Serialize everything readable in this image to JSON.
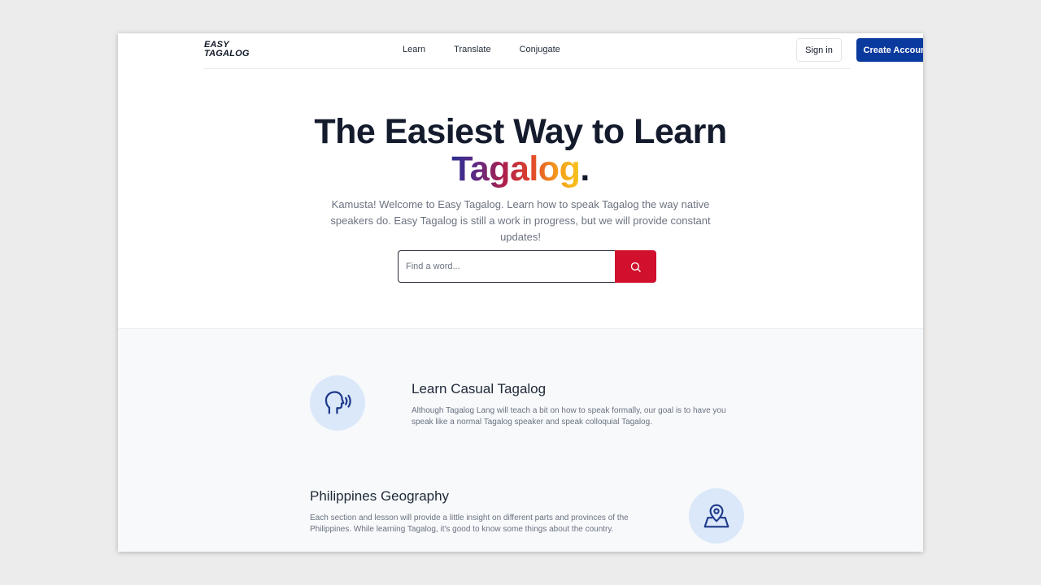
{
  "header": {
    "logo_line1": "EASY",
    "logo_line2": "TAGALOG",
    "nav": [
      "Learn",
      "Translate",
      "Conjugate"
    ],
    "sign_in": "Sign in",
    "create_account": "Create Account"
  },
  "hero": {
    "title_line1": "The Easiest Way to Learn",
    "title_word": "Tagalog",
    "title_punct": ".",
    "subtitle": "Kamusta! Welcome to Easy Tagalog. Learn how to speak Tagalog the way native speakers do. Easy Tagalog is still a work in progress, but we will provide constant updates!"
  },
  "search": {
    "placeholder": "Find a word...",
    "value": ""
  },
  "features": [
    {
      "title": "Learn Casual Tagalog",
      "text": "Although Tagalog Lang will teach a bit on how to speak formally, our goal is to have you speak like a normal Tagalog speaker and speak colloquial Tagalog.",
      "icon": "speaking-head-icon"
    },
    {
      "title": "Philippines Geography",
      "text": "Each section and lesson will provide a little insight on different parts and provinces of the Philippines. While learning Tagalog, it's good to know some things about the country.",
      "icon": "map-pin-icon"
    }
  ],
  "colors": {
    "primary_button": "#0a3a9e",
    "search_button": "#d0102c",
    "icon_circle": "#dbe8fa",
    "icon_stroke": "#1e3a8a"
  }
}
